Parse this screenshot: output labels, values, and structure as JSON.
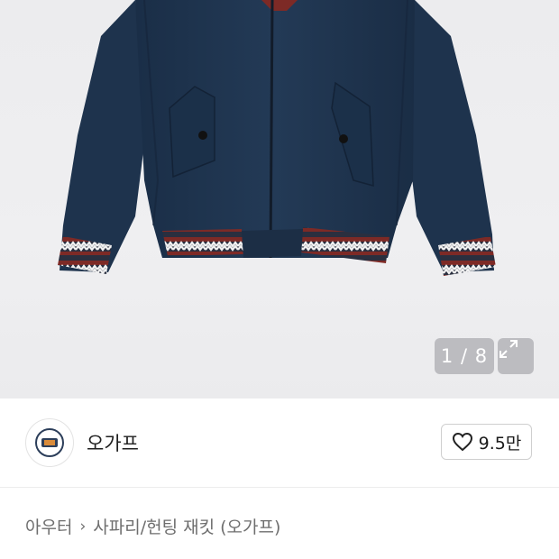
{
  "gallery": {
    "counter": "1 / 8",
    "expand_icon": "expand-arrows-icon",
    "image_alt": "navy harrington jacket with striped rib cuffs"
  },
  "seller": {
    "name": "오가프",
    "avatar_icon": "shop-logo-icon"
  },
  "like": {
    "icon": "heart-outline-icon",
    "count": "9.5만"
  },
  "breadcrumb": {
    "category": "아우터",
    "separator_icon": "chevron-right-icon",
    "item": "사파리/헌팅 재킷 (오가프)"
  },
  "colors": {
    "jacket": "#1f3550",
    "rib_red": "#8a2a24",
    "background": "#ededef"
  }
}
